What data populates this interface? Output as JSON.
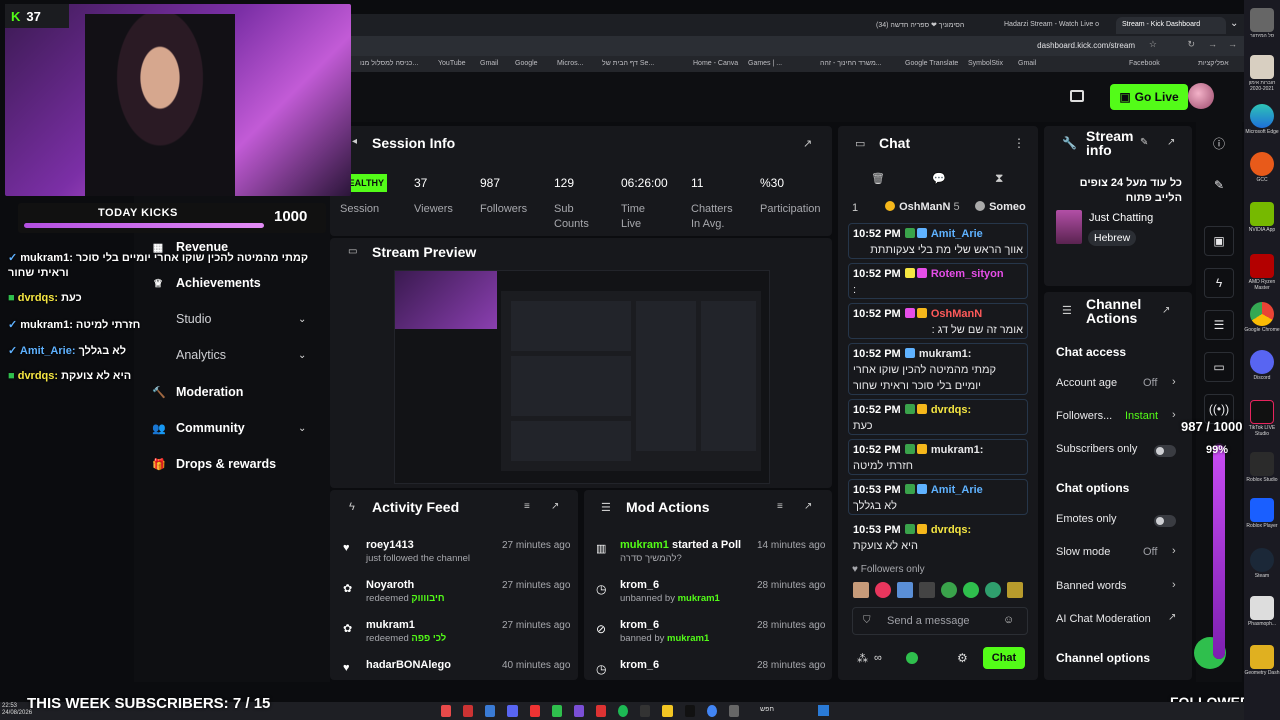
{
  "browser": {
    "tabs": [
      "הסימוניך ❤ ספריה חדשה (34)",
      "Hadarzi Stream - Watch Live o",
      "Stream - Kick Dashboard"
    ],
    "url": "dashboard.kick.com/stream",
    "bookmarks": [
      "כניסה למסלול מנו...",
      "YouTube",
      "Gmail",
      "Google",
      "Micros...",
      "דף הבית של Se...",
      "Home - Canva",
      "Games | ...",
      "משרד החינוך - זהה...",
      "Google Translate",
      "SymbolStix",
      "Gmail",
      "Facebook",
      "אפליקציות"
    ]
  },
  "header": {
    "go_live": "Go Live"
  },
  "overlay": {
    "kicks_count": "37",
    "today_kicks_label": "TODAY KICKS",
    "today_kicks_value": "1000",
    "week_subs": "THIS WEEK SUBSCRIBERS: 7 / 15",
    "followers_label": "FOLLOWERS",
    "followers_progress_text": "987 / 1000",
    "followers_percent": "99%",
    "followers_fill": 0.99,
    "chat_lines": [
      {
        "user": "mukram1:",
        "text": "קמתי מהמיטה להכין שוקו אחרי יומיים בלי סוכר וראיתי שחור"
      },
      {
        "user": "dvrdqs:",
        "text": "כעת"
      },
      {
        "user": "mukram1:",
        "text": "חזרתי למיטה"
      },
      {
        "user": "Amit_Arie:",
        "text": "לא בגללך"
      },
      {
        "user": "dvrdqs:",
        "text": "היא לא צועקת"
      }
    ]
  },
  "nav": {
    "revenue": "Revenue",
    "achievements": "Achievements",
    "studio": "Studio",
    "analytics": "Analytics",
    "moderation": "Moderation",
    "community": "Community",
    "drops": "Drops & rewards"
  },
  "session": {
    "title": "Session Info",
    "health": "HEALTHY",
    "session_label": "Session",
    "stats": [
      {
        "value": "37",
        "label": "Viewers"
      },
      {
        "value": "987",
        "label": "Followers"
      },
      {
        "value": "129",
        "label": "Sub Counts"
      },
      {
        "value": "06:26:00",
        "label": "Time Live"
      },
      {
        "value": "11",
        "label": "Chatters In Avg."
      },
      {
        "value": "%30",
        "label": "Participation"
      }
    ]
  },
  "preview": {
    "title": "Stream Preview"
  },
  "activity": {
    "title": "Activity Feed",
    "items": [
      {
        "name": "roey1413",
        "sub": "just followed the channel",
        "time": "27 minutes ago"
      },
      {
        "name": "Noyaroth",
        "sub": "redeemed",
        "reward": "חיבווווק",
        "time": "27 minutes ago"
      },
      {
        "name": "mukram1",
        "sub": "redeemed",
        "reward": "לכי פפה",
        "time": "27 minutes ago"
      },
      {
        "name": "hadarBONAlego",
        "sub": "",
        "time": "40 minutes ago"
      }
    ]
  },
  "mod": {
    "title": "Mod Actions",
    "items": [
      {
        "name": "mukram1",
        "action": "started a Poll",
        "sub": "להמשיך סדרה?",
        "time": "14 minutes ago"
      },
      {
        "name": "krom_6",
        "action": "",
        "sub": "unbanned by",
        "by": "mukram1",
        "time": "28 minutes ago"
      },
      {
        "name": "krom_6",
        "action": "",
        "sub": "banned by",
        "by": "mukram1",
        "time": "28 minutes ago"
      },
      {
        "name": "krom_6",
        "action": "",
        "sub": "",
        "time": "28 minutes ago"
      }
    ]
  },
  "chat": {
    "title": "Chat",
    "pinned_count": "1",
    "pinned_user": "OshManN",
    "pinned_num": "5",
    "pinned_user2": "Someo",
    "messages": [
      {
        "time": "10:52 PM",
        "user": "Amit_Arie",
        "color": "#5fb2ff",
        "text": "אווך הראש שלי מת בלי צעקותתת"
      },
      {
        "time": "10:52 PM",
        "user": "Rotem_sityon",
        "color": "#e64ee8",
        "text": ":"
      },
      {
        "time": "10:52 PM",
        "user": "OshManN",
        "color": "#ff5a5a",
        "text": "אומר זה שם של דג :"
      },
      {
        "time": "10:52 PM",
        "user": "mukram1:",
        "color": "#ffffff",
        "text": "קמתי מהמיטה להכין שוקו אחרי יומיים בלי סוכר וראיתי שחור"
      },
      {
        "time": "10:52 PM",
        "user": "dvrdqs:",
        "color": "#f5e642",
        "text": "כעת"
      },
      {
        "time": "10:52 PM",
        "user": "mukram1:",
        "color": "#ffffff",
        "text": "חזרתי למיטה"
      },
      {
        "time": "10:53 PM",
        "user": "Amit_Arie",
        "color": "#5fb2ff",
        "text": "לא בגללך"
      },
      {
        "time": "10:53 PM",
        "user": "dvrdqs:",
        "color": "#f5e642",
        "text": "היא לא צועקת"
      }
    ],
    "followers_only": "Followers only",
    "input_placeholder": "Send a message",
    "send": "Chat"
  },
  "stream_info": {
    "title": "Stream info",
    "stream_title": "כל עוד מעל 24 צופים הלייב פתוח",
    "category": "Just Chatting",
    "language": "Hebrew"
  },
  "channel_actions": {
    "title": "Channel Actions",
    "chat_access": "Chat access",
    "account_age": "Account age",
    "account_age_val": "Off",
    "followers": "Followers...",
    "followers_val": "Instant",
    "subs_only": "Subscribers only",
    "chat_options": "Chat options",
    "emotes_only": "Emotes only",
    "slow_mode": "Slow mode",
    "slow_mode_val": "Off",
    "banned_words": "Banned words",
    "ai_mod": "AI Chat Moderation",
    "channel_options": "Channel options"
  },
  "desktop": {
    "labels": [
      "סל המיחזור",
      "חוברות אימון 2020-2021",
      "Microsoft Edge",
      "GCC",
      "NVIDIA App",
      "AMD Ryzen Master",
      "Google Chrome",
      "Discord",
      "TikTok LIVE Studio",
      "Roblox Studio",
      "Roblox Player",
      "Steam",
      "Phasmoph...",
      "Geometry Dash"
    ],
    "taskbar_time": "22:53",
    "taskbar_date": "24/08/2026",
    "search": "חפש"
  }
}
